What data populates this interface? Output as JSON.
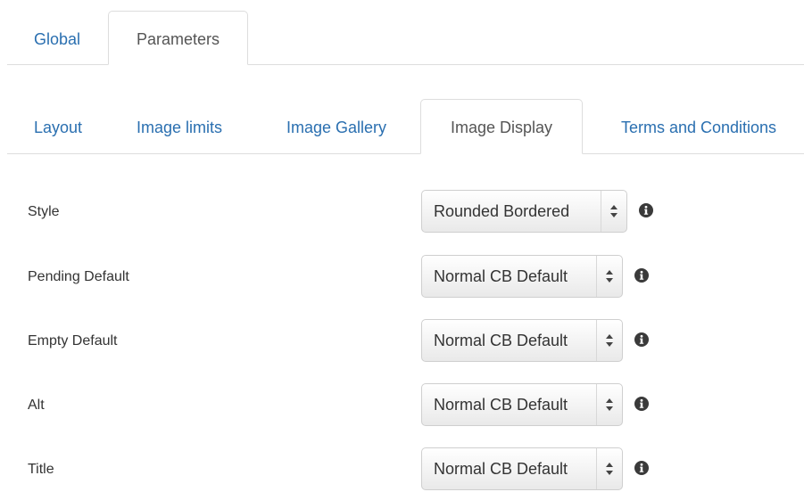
{
  "top_tabs": [
    {
      "label": "Global",
      "active": false
    },
    {
      "label": "Parameters",
      "active": true
    }
  ],
  "sub_tabs": [
    {
      "label": "Layout",
      "active": false
    },
    {
      "label": "Image limits",
      "active": false
    },
    {
      "label": "Image Gallery",
      "active": false
    },
    {
      "label": "Image Display",
      "active": true
    },
    {
      "label": "Terms and Conditions",
      "active": false
    }
  ],
  "fields": [
    {
      "label": "Style",
      "value": "Rounded Bordered"
    },
    {
      "label": "Pending Default",
      "value": "Normal CB Default"
    },
    {
      "label": "Empty Default",
      "value": "Normal CB Default"
    },
    {
      "label": "Alt",
      "value": "Normal CB Default"
    },
    {
      "label": "Title",
      "value": "Normal CB Default"
    }
  ],
  "icons": {
    "select_arrows": "sort-arrows-icon",
    "help": "info-circle-icon"
  },
  "colors": {
    "link": "#2a6fb0",
    "active_tab_text": "#555555",
    "border": "#dddddd"
  }
}
